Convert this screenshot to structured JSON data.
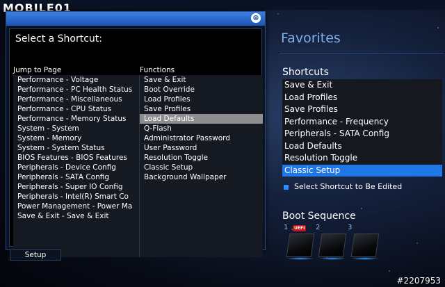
{
  "watermark": {
    "logo": "MOBILE01",
    "id": "#2207953"
  },
  "dialog": {
    "heading": "Select a Shortcut:",
    "close_glyph": "⊗",
    "jump_header": "Jump to Page",
    "functions_header": "Functions",
    "jump_items": [
      "Performance - Voltage",
      "Performance - PC Health Status",
      "Performance - Miscellaneous",
      "Performance - CPU Status",
      "Performance - Memory Status",
      "System - System",
      "System - Memory",
      "System - System Status",
      "BIOS Features - BIOS Features",
      "Peripherals - Device Config",
      "Peripherals - SATA Config",
      "Peripherals - Super IO Config",
      "Peripherals - Intel(R) Smart Co",
      "Power Management - Power Ma",
      "Save & Exit - Save & Exit"
    ],
    "function_items": [
      "Save & Exit",
      "Boot Override",
      "Load Profiles",
      "Save Profiles",
      "Load Defaults",
      "Q-Flash",
      "Administrator Password",
      "User Password",
      "Resolution Toggle",
      "Classic Setup",
      "Background Wallpaper"
    ],
    "selected_function": "Load Defaults"
  },
  "setup_tab_label": "Setup",
  "favorites": {
    "title": "Favorites",
    "shortcuts_title": "Shortcuts",
    "shortcuts": [
      "Save & Exit",
      "Load Profiles",
      "Save Profiles",
      "Performance - Frequency",
      "Peripherals - SATA Config",
      "Load Defaults",
      "Resolution Toggle",
      "Classic Setup"
    ],
    "selected_shortcut": "Classic Setup",
    "edit_note": "Select Shortcut to Be Edited"
  },
  "boot": {
    "title": "Boot Sequence",
    "slots": [
      "1",
      "2",
      "3"
    ],
    "badge": "UEFI"
  },
  "colors": {
    "accent": "#1f78e6",
    "title_bar": "#3d7fe0",
    "favorites_title": "#7fb2e8",
    "selection_gray": "#8e8e8e"
  }
}
